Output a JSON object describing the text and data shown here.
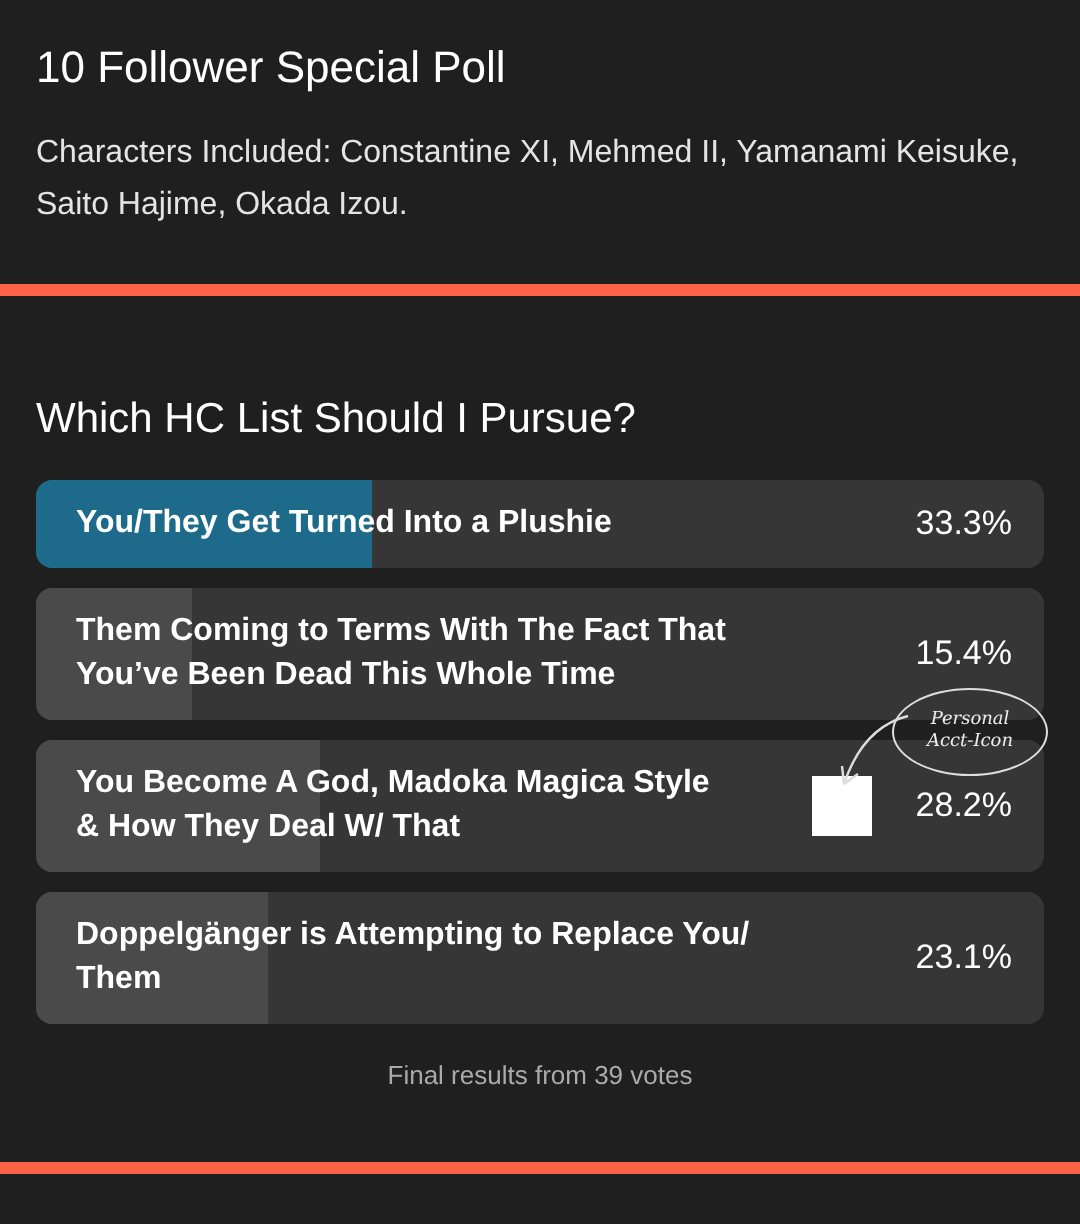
{
  "post": {
    "title": "10 Follower Special Poll",
    "body": "Characters Included: Constantine XI, Mehmed II, Yamanami Keisuke, Saito Hajime, Okada Izou."
  },
  "poll": {
    "question": "Which HC List Should I Pursue?",
    "options": [
      {
        "label": "You/They Get Turned Into a Plushie",
        "percent": "33.3%",
        "level": 0.333,
        "selected": true,
        "voter_avatar": false
      },
      {
        "label": "Them Coming to Terms With The Fact That You’ve Been Dead This Whole Time",
        "percent": "15.4%",
        "level": 0.154,
        "selected": false,
        "voter_avatar": false
      },
      {
        "label": "You Become A God, Madoka Magica Style & How They Deal W/ That",
        "percent": "28.2%",
        "level": 0.282,
        "selected": false,
        "voter_avatar": true
      },
      {
        "label": "Doppelgänger is Attempting to Replace You/ Them",
        "percent": "23.1%",
        "level": 0.231,
        "selected": false,
        "voter_avatar": false
      }
    ],
    "footer": "Final results from 39 votes"
  },
  "annotation": {
    "lines": [
      "Personal",
      "Acct-Icon"
    ]
  }
}
